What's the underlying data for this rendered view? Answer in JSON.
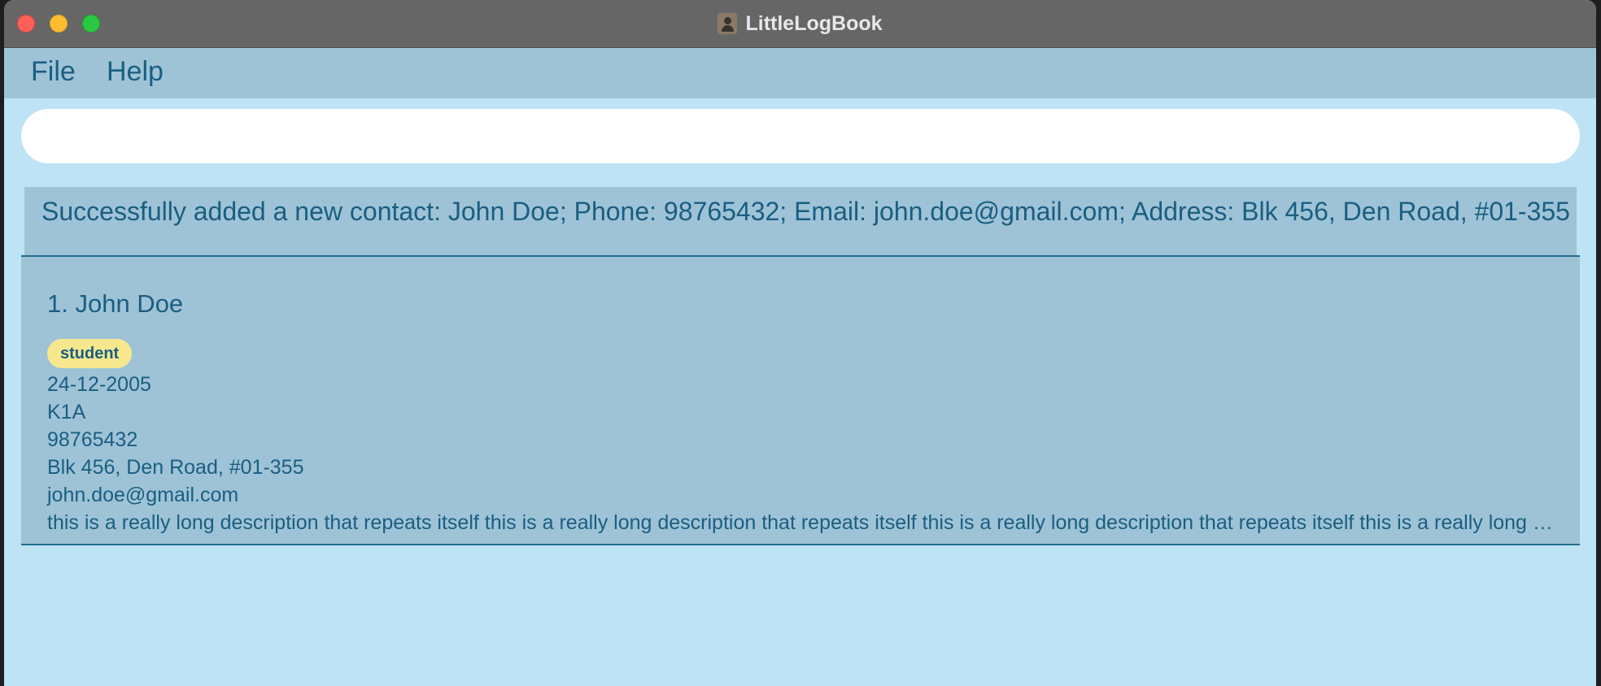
{
  "window": {
    "title": "LittleLogBook"
  },
  "menu": {
    "file_label": "File",
    "help_label": "Help"
  },
  "command": {
    "value": "",
    "placeholder": ""
  },
  "result": {
    "message": "Successfully added a new contact: John Doe; Phone: 98765432; Email: john.doe@gmail.com; Address: Blk 456, Den Road, #01-355"
  },
  "contacts": [
    {
      "index_name": "1. John Doe",
      "tag": "student",
      "dob": "24-12-2005",
      "class": "K1A",
      "phone": "98765432",
      "address": "Blk 456, Den Road, #01-355",
      "email": "john.doe@gmail.com",
      "description": "this is a really long description that repeats itself this is a really long description that repeats itself this is a really long description that repeats itself this is a really long descript..."
    }
  ],
  "colors": {
    "accent_text": "#1a5e80",
    "panel_bg": "#9ec3d7",
    "content_bg": "#bde3f4",
    "tag_bg": "#f7e88e",
    "titlebar_bg": "#666666"
  },
  "icons": {
    "app": "contact-book-icon"
  }
}
